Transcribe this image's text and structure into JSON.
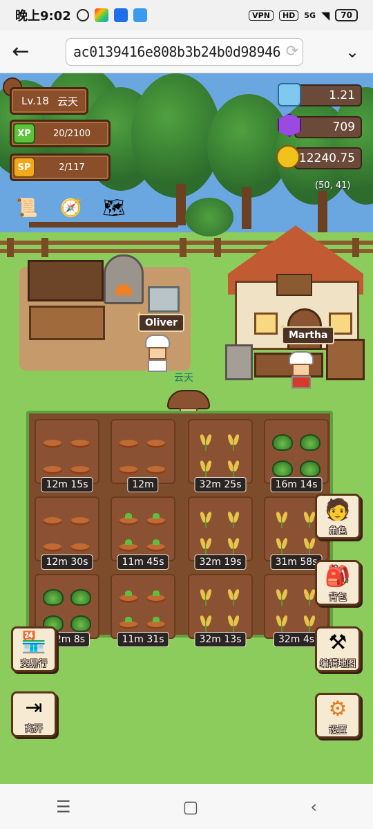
{
  "status_bar": {
    "time": "晚上9:02",
    "vpn": "VPN",
    "hd": "HD",
    "signal": "5G",
    "battery": "70"
  },
  "browser": {
    "url_text": "ac0139416e808b3b24b0d98946"
  },
  "hud": {
    "level": "Lv.18",
    "player_name": "云天",
    "xp_badge": "XP",
    "xp": "20/2100",
    "sp_badge": "SP",
    "sp": "2/117",
    "crystal": "1.21",
    "gem": "709",
    "coins": "12240.75",
    "coords": "(50, 41)"
  },
  "npcs": {
    "chef1": "Oliver",
    "chef2": "Martha",
    "player": "云天"
  },
  "plots": [
    {
      "timer": "12m 15s",
      "crop": "seed"
    },
    {
      "timer": "12m",
      "crop": "seed"
    },
    {
      "timer": "32m 25s",
      "crop": "wheat"
    },
    {
      "timer": "16m 14s",
      "crop": "cabbage"
    },
    {
      "timer": "12m 30s",
      "crop": "seed"
    },
    {
      "timer": "11m 45s",
      "crop": "sprout"
    },
    {
      "timer": "32m 19s",
      "crop": "wheat"
    },
    {
      "timer": "31m 58s",
      "crop": "wheat"
    },
    {
      "timer": "12m 8s",
      "crop": "cabbage"
    },
    {
      "timer": "11m 31s",
      "crop": "sprout"
    },
    {
      "timer": "32m 13s",
      "crop": "wheat"
    },
    {
      "timer": "32m 4s",
      "crop": "wheat"
    }
  ],
  "side_buttons": {
    "character": "角色",
    "backpack": "背包",
    "edit_map": "编辑地图",
    "settings": "设置",
    "market": "交易行",
    "leave": "离开"
  },
  "colors": {
    "hud_wood": "#8a4e2a",
    "grass": "#8ccc5c",
    "soil": "#8a5232"
  }
}
